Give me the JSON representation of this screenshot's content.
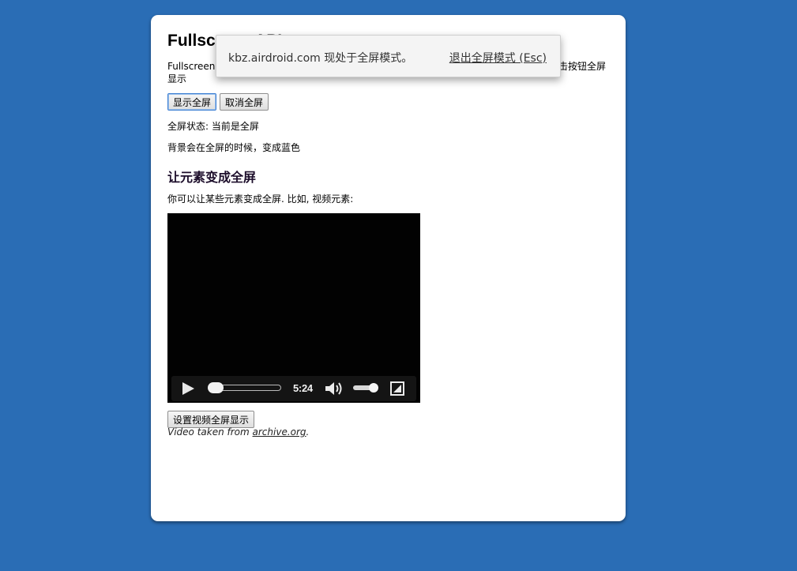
{
  "page": {
    "title": "Fullscreen API",
    "intro_left": "Fullscreen",
    "intro_right": "击按钮全屏",
    "intro_wrap": "显示",
    "buttons": {
      "show_fullscreen": "显示全屏",
      "cancel_fullscreen": "取消全屏"
    },
    "status": "全屏状态: 当前是全屏",
    "background_note": "背景会在全屏的时候，变成蓝色",
    "section_title": "让元素变成全屏",
    "section_desc": "你可以让某些元素变成全屏. 比如, 视频元素:",
    "video": {
      "duration": "5:24",
      "progress": 0,
      "volume": 1.0,
      "icons": [
        "play-icon",
        "volume-icon",
        "fullscreen-icon"
      ]
    },
    "video_fullscreen_button": "设置视频全屏显示",
    "credit_prefix": "Video taken from ",
    "credit_link": "archive.org",
    "credit_suffix": "."
  },
  "notification": {
    "message": "kbz.airdroid.com 现处于全屏模式。",
    "exit_link": "退出全屏模式 (Esc)"
  },
  "colors": {
    "background": "#2a6db5",
    "card": "#ffffff",
    "video": "#020202"
  }
}
